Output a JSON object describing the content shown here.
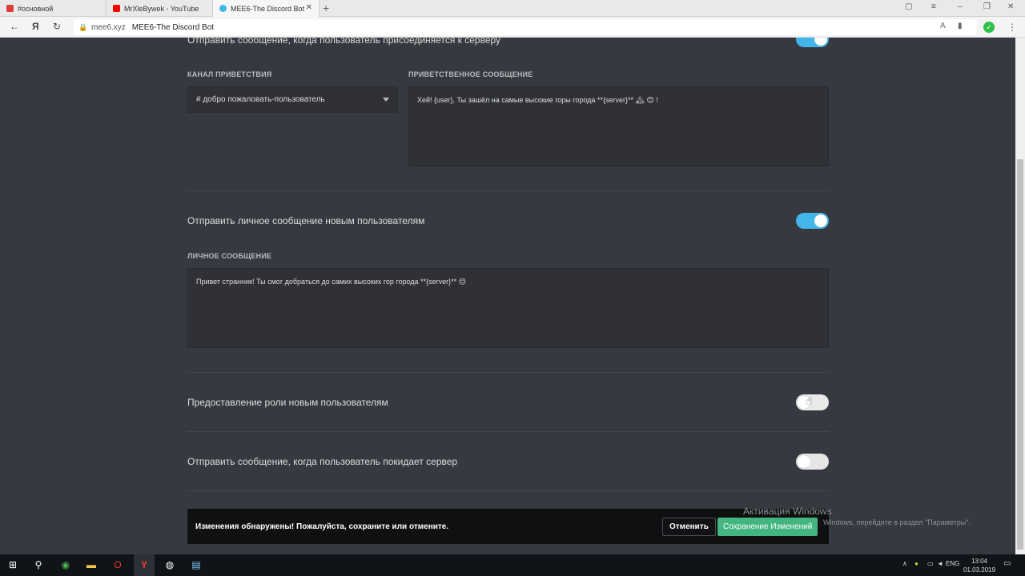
{
  "browser": {
    "tabs": [
      {
        "title": "#основной",
        "color": "#e03b3b"
      },
      {
        "title": "MrXleBywek - YouTube",
        "color": "#ff0000"
      },
      {
        "title": "MEE6-The Discord Bot",
        "color": "#3fb6e8",
        "active": true
      }
    ],
    "domain": "mee6.xyz",
    "page_title": "MEE6-The Discord Bot"
  },
  "welcome": {
    "join_toggle_label": "Отправить сообщение, когда пользователь присоединяется к серверу",
    "channel_label": "КАНАЛ ПРИВЕТСТВИЯ",
    "channel_value": "# добро пожаловать-пользователь",
    "message_label": "ПРИВЕТСТВЕННОЕ СООБЩЕНИЕ",
    "message_value": "Хей! {user}, Ты зашёл на самые высокие горы города **{server}** 🏔 😊 !"
  },
  "dm": {
    "toggle_label": "Отправить личное сообщение новым пользователям",
    "message_label": "ЛИЧНОЕ СООБЩЕНИЕ",
    "message_value": "Привет странник! Ты смог добраться до самих высоких гор города **{server}** 😊"
  },
  "role": {
    "toggle_label": "Предоставление роли новым пользователям"
  },
  "leave": {
    "toggle_label": "Отправить сообщение, когда пользователь покидает сервер"
  },
  "notice": {
    "message": "Изменения обнаружены! Пожалуйста, сохраните или отмените.",
    "cancel_label": "Отменить",
    "save_label": "Сохранение Изменений"
  },
  "watermark": {
    "line1": "Активация Windows",
    "line2": "Windows, перейдите в раздел \"Параметры\"."
  },
  "taskbar": {
    "lang": "ENG",
    "time": "13:04",
    "date": "01.03.2019"
  }
}
